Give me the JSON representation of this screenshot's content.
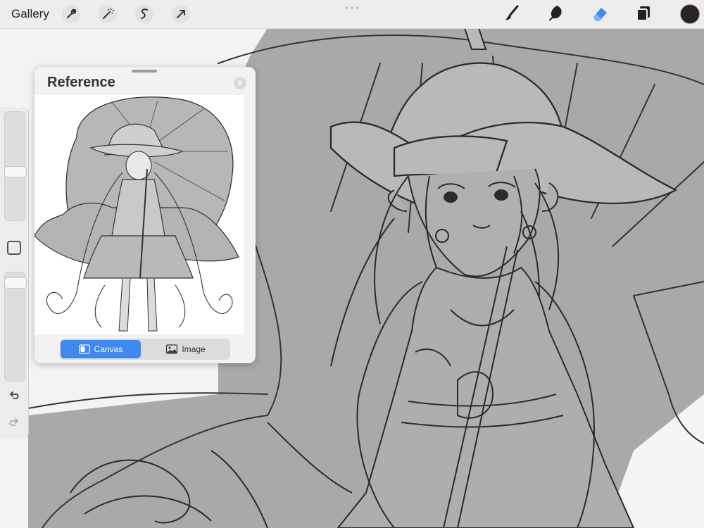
{
  "topbar": {
    "gallery_label": "Gallery",
    "left_tools": [
      "wrench-icon",
      "magic-wand-icon",
      "selection-icon",
      "transform-arrow-icon"
    ],
    "right_tools": [
      "brush-icon",
      "smudge-icon",
      "eraser-icon",
      "layers-icon"
    ],
    "active_tool": "eraser-icon",
    "current_color": "#2a2322",
    "accent_color": "#3f88f0"
  },
  "sidebar": {
    "size_slider_level": 0.45,
    "opacity_slider_level": 0.95
  },
  "reference": {
    "title": "Reference",
    "tabs": [
      {
        "label": "Canvas",
        "active": true
      },
      {
        "label": "Image",
        "active": false
      }
    ]
  }
}
